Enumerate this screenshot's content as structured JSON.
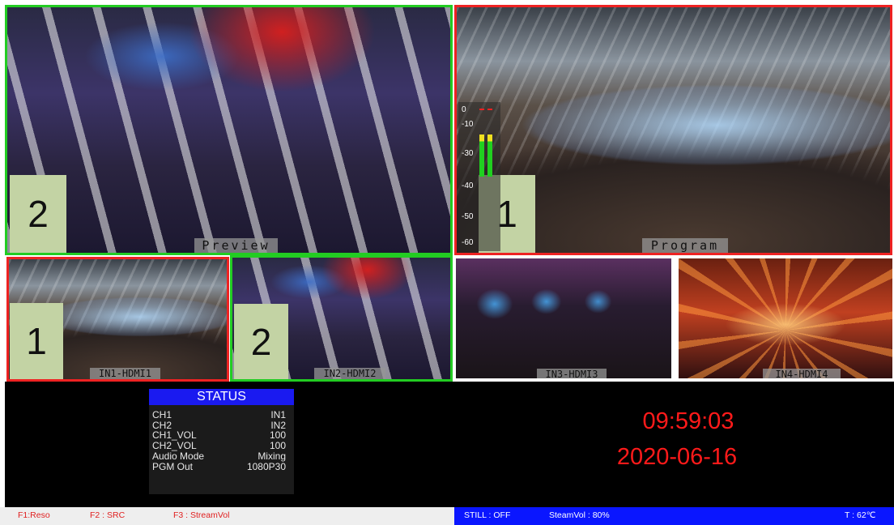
{
  "preview": {
    "label": "Preview",
    "number": "2",
    "border_color": "#22cc22"
  },
  "program": {
    "label": "Program",
    "number": "1",
    "border_color": "#ee2222"
  },
  "inputs": [
    {
      "label": "IN1-HDMI1",
      "number": "1",
      "border_color": "#ee2222"
    },
    {
      "label": "IN2-HDMI2",
      "number": "2",
      "border_color": "#22cc22"
    },
    {
      "label": "IN3-HDMI3",
      "number": "",
      "border_color": "#ffffff"
    },
    {
      "label": "IN4-HDMI4",
      "number": "",
      "border_color": "#ffffff"
    }
  ],
  "vu_meter": {
    "ticks": [
      "0",
      "-10",
      "-30",
      "-40",
      "-50",
      "-60"
    ]
  },
  "status": {
    "title": "STATUS",
    "rows": [
      {
        "key": "CH1",
        "value": "IN1"
      },
      {
        "key": "CH2",
        "value": "IN2"
      },
      {
        "key": "CH1_VOL",
        "value": "100"
      },
      {
        "key": "CH2_VOL",
        "value": "100"
      },
      {
        "key": "Audio Mode",
        "value": "Mixing"
      },
      {
        "key": "PGM Out",
        "value": "1080P30"
      }
    ]
  },
  "clock": {
    "time": "09:59:03",
    "date": "2020-06-16"
  },
  "footer": {
    "keys": [
      "F1:Reso",
      "F2 : SRC",
      "F3 : StreamVol"
    ],
    "still": "STILL : OFF",
    "stream_vol": "SteamVol : 80%",
    "temp": "T : 62℃"
  },
  "colors": {
    "accent_blue": "#0a16ff",
    "clock_red": "#ff1a1a",
    "tally_green": "#22cc22",
    "tally_red": "#ee2222"
  }
}
